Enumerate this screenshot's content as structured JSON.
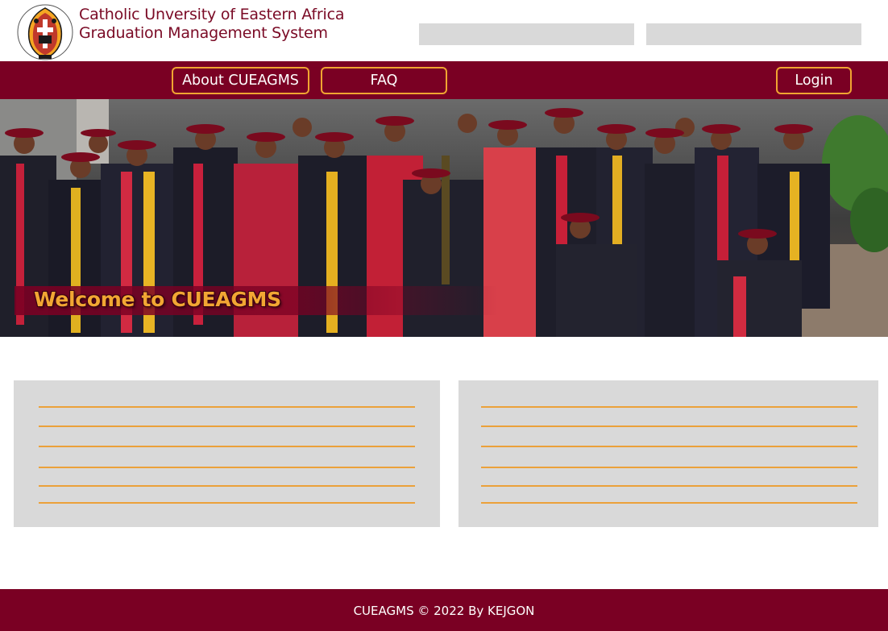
{
  "header": {
    "title_line1": "Catholic Unversity of Eastern Africa",
    "title_line2": "Graduation Management System",
    "logo_icon": "university-crest-icon"
  },
  "nav": {
    "about_label": "About CUEAGMS",
    "faq_label": "FAQ",
    "login_label": "Login"
  },
  "hero": {
    "welcome_text": "Welcome to CUEAGMS",
    "image": "graduation-group-photo"
  },
  "panels": [
    {
      "lines": 6
    },
    {
      "lines": 6
    }
  ],
  "footer": {
    "text": "CUEAGMS © 2022 By KEJGON"
  },
  "colors": {
    "brand_maroon": "#7a0023",
    "accent_orange": "#f0a531",
    "placeholder_gray": "#d9d9d9"
  }
}
